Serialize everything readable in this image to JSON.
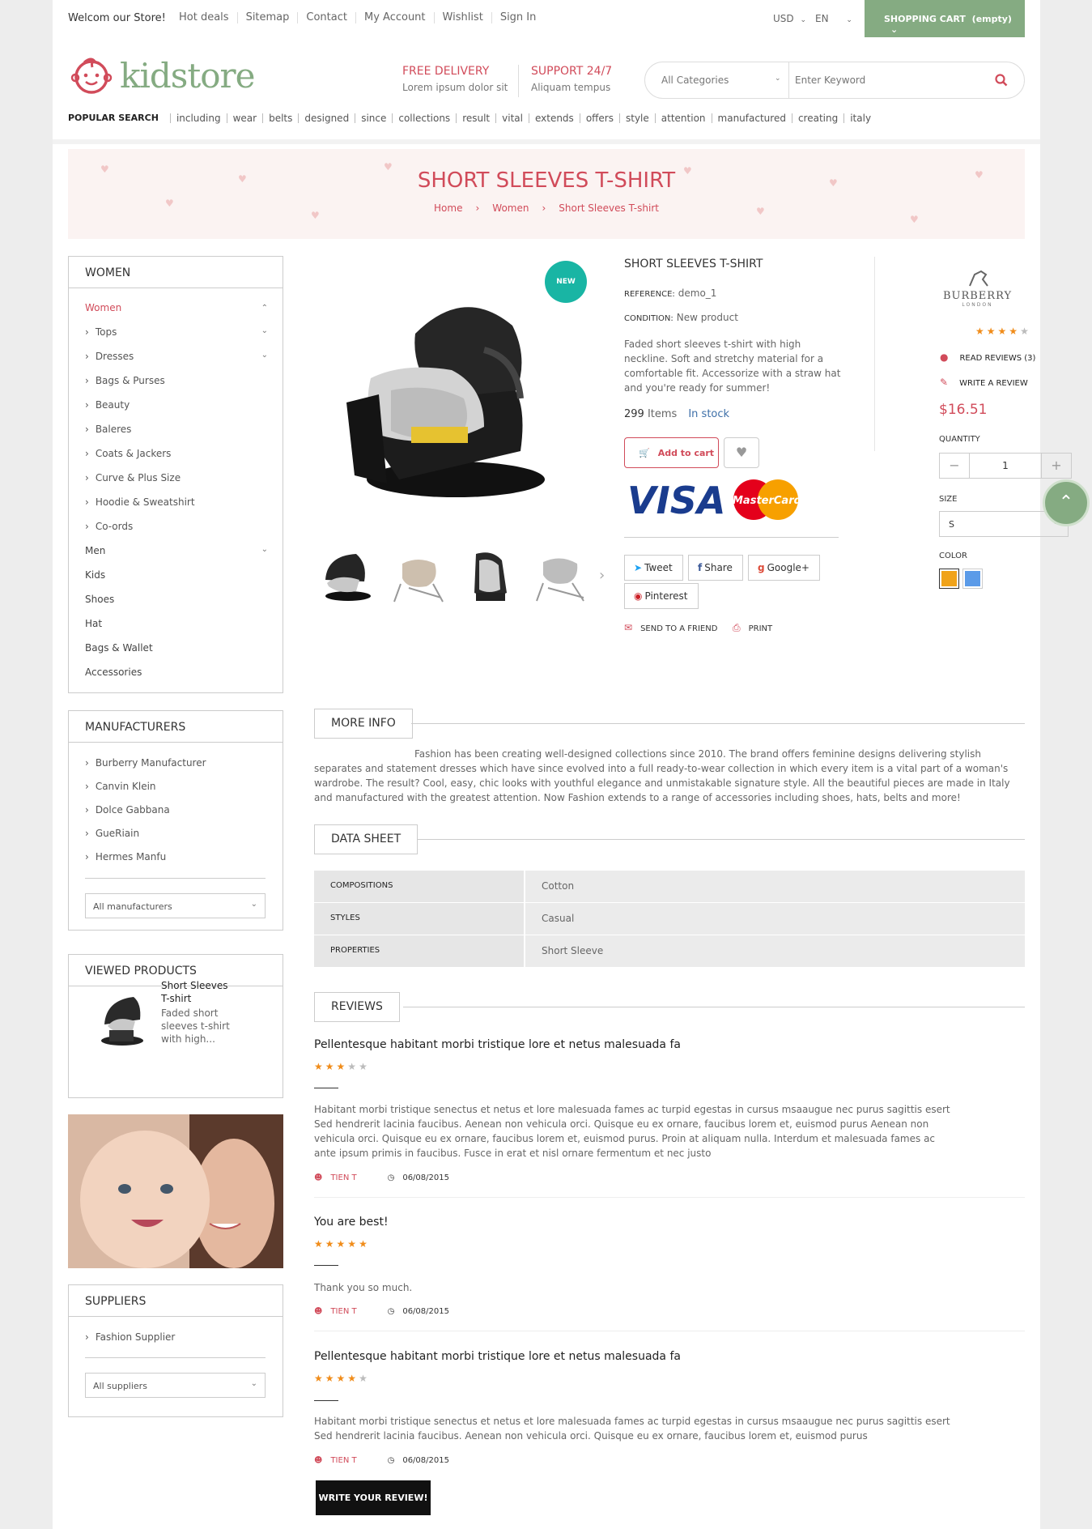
{
  "topbar": {
    "welcome": "Welcom our Store!",
    "links": [
      "Hot deals",
      "Sitemap",
      "Contact",
      "My Account",
      "Wishlist",
      "Sign In"
    ],
    "currency": "USD",
    "language": "EN",
    "cart_label": "SHOPPING CART",
    "cart_status": "(empty)"
  },
  "header": {
    "logo_text": "kidstore",
    "promo1_title": "FREE DELIVERY",
    "promo1_sub": "Lorem ipsum dolor sit",
    "promo2_title": "SUPPORT 24/7",
    "promo2_sub": "Aliquam tempus",
    "search_category": "All Categories",
    "search_placeholder": "Enter Keyword",
    "popular_label": "POPULAR SEARCH",
    "popular_keywords": [
      "including",
      "wear",
      "belts",
      "designed",
      "since",
      "collections",
      "result",
      "vital",
      "extends",
      "offers",
      "style",
      "attention",
      "manufactured",
      "creating",
      "italy"
    ]
  },
  "banner": {
    "title": "SHORT SLEEVES T-SHIRT",
    "crumbs": [
      "Home",
      "Women",
      "Short Sleeves T-shirt"
    ]
  },
  "categories": {
    "title": "WOMEN",
    "items": [
      {
        "label": "Women",
        "level": 0,
        "active": true,
        "chevron": "up"
      },
      {
        "label": "Tops",
        "level": 1,
        "chevron": "down"
      },
      {
        "label": "Dresses",
        "level": 1,
        "chevron": "down"
      },
      {
        "label": "Bags & Purses",
        "level": 1
      },
      {
        "label": "Beauty",
        "level": 1
      },
      {
        "label": "Baleres",
        "level": 1
      },
      {
        "label": "Coats & Jackers",
        "level": 1
      },
      {
        "label": "Curve & Plus Size",
        "level": 1
      },
      {
        "label": "Hoodie & Sweatshirt",
        "level": 1
      },
      {
        "label": "Co-ords",
        "level": 1
      },
      {
        "label": "Men",
        "level": 0,
        "chevron": "down"
      },
      {
        "label": "Kids",
        "level": 0
      },
      {
        "label": "Shoes",
        "level": 0
      },
      {
        "label": "Hat",
        "level": 0
      },
      {
        "label": "Bags & Wallet",
        "level": 0
      },
      {
        "label": "Accessories",
        "level": 0
      }
    ]
  },
  "manufacturers": {
    "title": "MANUFACTURERS",
    "items": [
      "Burberry Manufacturer",
      "Canvin Klein",
      "Dolce Gabbana",
      "GueRiain",
      "Hermes Manfu"
    ],
    "select": "All manufacturers"
  },
  "viewed": {
    "title": "VIEWED PRODUCTS",
    "name": "Short Sleeves T-shirt",
    "desc": "Faded short sleeves t-shirt with high..."
  },
  "suppliers": {
    "title": "SUPPLIERS",
    "items": [
      "Fashion Supplier"
    ],
    "select": "All suppliers"
  },
  "product": {
    "badge": "NEW",
    "name": "SHORT SLEEVES T-SHIRT",
    "reference_label": "REFERENCE:",
    "reference": "demo_1",
    "condition_label": "CONDITION:",
    "condition": "New product",
    "description": "Faded short sleeves t-shirt with high neckline. Soft and stretchy material for a comfortable fit. Accessorize with a straw hat and you're ready for summer!",
    "quantity_count": "299",
    "items_label": "Items",
    "stock": "In stock",
    "add_to_cart": "Add to cart",
    "share_buttons": [
      "Tweet",
      "Share",
      "Google+",
      "Pinterest"
    ],
    "send_friend": "SEND TO A FRIEND",
    "print": "PRINT",
    "brand": "BURBERRY",
    "brand_sub": "LONDON",
    "rating": 4,
    "read_reviews": "READ REVIEWS (3)",
    "write_review": "WRITE A REVIEW",
    "price": "$16.51",
    "quantity_label": "QUANTITY",
    "quantity": "1",
    "size_label": "SIZE",
    "size": "S",
    "color_label": "COLOR",
    "colors": [
      "#f0a31a",
      "#5b9be8"
    ]
  },
  "more_info": {
    "title": "MORE INFO",
    "text": "Fashion has been creating well-designed collections since 2010. The brand offers feminine designs delivering stylish separates and statement dresses which have since evolved into a full ready-to-wear collection in which every item is a vital part of a woman's wardrobe. The result? Cool, easy, chic looks with youthful elegance and unmistakable signature style. All the beautiful pieces are made in Italy and manufactured with the greatest attention. Now Fashion extends to a range of accessories including shoes, hats, belts and more!"
  },
  "data_sheet": {
    "title": "DATA SHEET",
    "rows": [
      {
        "key": "COMPOSITIONS",
        "value": "Cotton"
      },
      {
        "key": "STYLES",
        "value": "Casual"
      },
      {
        "key": "PROPERTIES",
        "value": "Short Sleeve"
      }
    ]
  },
  "reviews": {
    "title": "REVIEWS",
    "items": [
      {
        "title": "Pellentesque habitant morbi tristique lore et netus malesuada fa",
        "rating": 3,
        "body": "Habitant morbi tristique senectus et netus et lore malesuada fames ac turpid egestas in cursus msaaugue nec purus sagittis esert Sed hendrerit lacinia faucibus. Aenean non vehicula orci. Quisque eu ex ornare, faucibus lorem et, euismod purus Aenean non vehicula orci. Quisque eu ex ornare, faucibus lorem et, euismod purus. Proin at aliquam nulla. Interdum et malesuada fames ac ante ipsum primis in faucibus. Fusce in erat et nisl ornare fermentum et nec justo",
        "author": "TIEN T",
        "date": "06/08/2015"
      },
      {
        "title": "You are best!",
        "rating": 5,
        "body": "Thank you so much.",
        "author": "TIEN T",
        "date": "06/08/2015"
      },
      {
        "title": "Pellentesque habitant morbi tristique lore et netus malesuada fa",
        "rating": 4,
        "body": "Habitant morbi tristique senectus et netus et lore malesuada fames ac turpid egestas in cursus msaaugue nec purus sagittis esert Sed hendrerit lacinia faucibus. Aenean non vehicula orci. Quisque eu ex ornare, faucibus lorem et, euismod purus",
        "author": "TIEN T",
        "date": "06/08/2015"
      }
    ],
    "write_button": "WRITE YOUR REVIEW!"
  },
  "colors": {
    "accent": "#d14b5a",
    "brand_green": "#85ab82",
    "star": "#f08c1a",
    "stock_blue": "#3d6fa8"
  }
}
